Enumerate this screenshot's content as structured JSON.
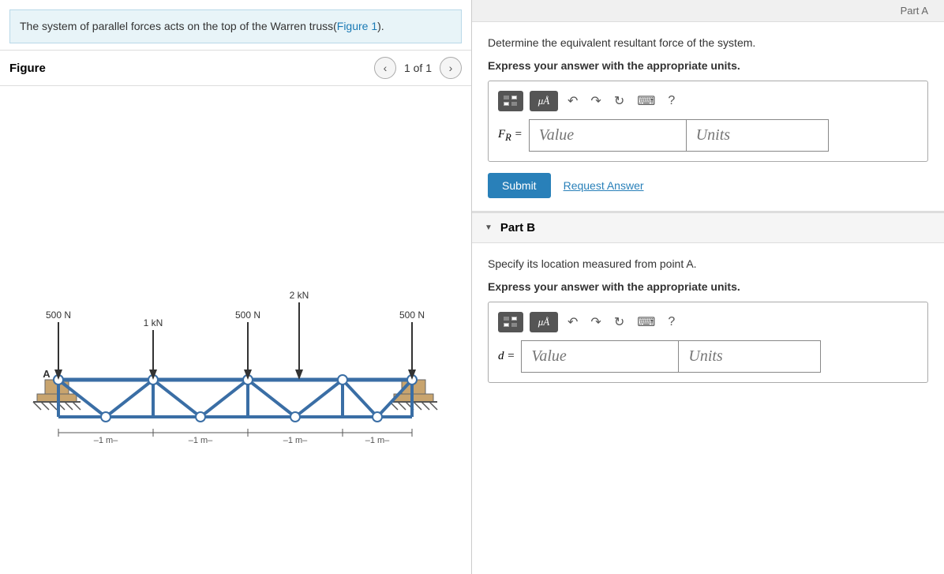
{
  "left": {
    "description": "The system of parallel forces acts on the top of the Warren truss(",
    "figure_link": "Figure 1",
    "description_end": ").",
    "figure_label": "Figure",
    "page_indicator": "1 of 1",
    "forces": {
      "f1": "500 N",
      "f2": "1 kN",
      "f3": "500 N",
      "f4": "2 kN",
      "f5": "500 N"
    },
    "spacings": "1 m"
  },
  "right": {
    "part_a": {
      "header": "Part A",
      "instruction1": "Determine the equivalent resultant force of the system.",
      "instruction2": "Express your answer with the appropriate units.",
      "variable_label": "F",
      "variable_subscript": "R",
      "variable_eq": "=",
      "value_placeholder": "Value",
      "units_placeholder": "Units",
      "submit_label": "Submit",
      "request_label": "Request Answer"
    },
    "part_b": {
      "header": "Part B",
      "instruction1": "Specify its location measured from point A.",
      "instruction2": "Express your answer with the appropriate units.",
      "variable_label": "d",
      "variable_eq": "=",
      "value_placeholder": "Value",
      "units_placeholder": "Units"
    }
  }
}
